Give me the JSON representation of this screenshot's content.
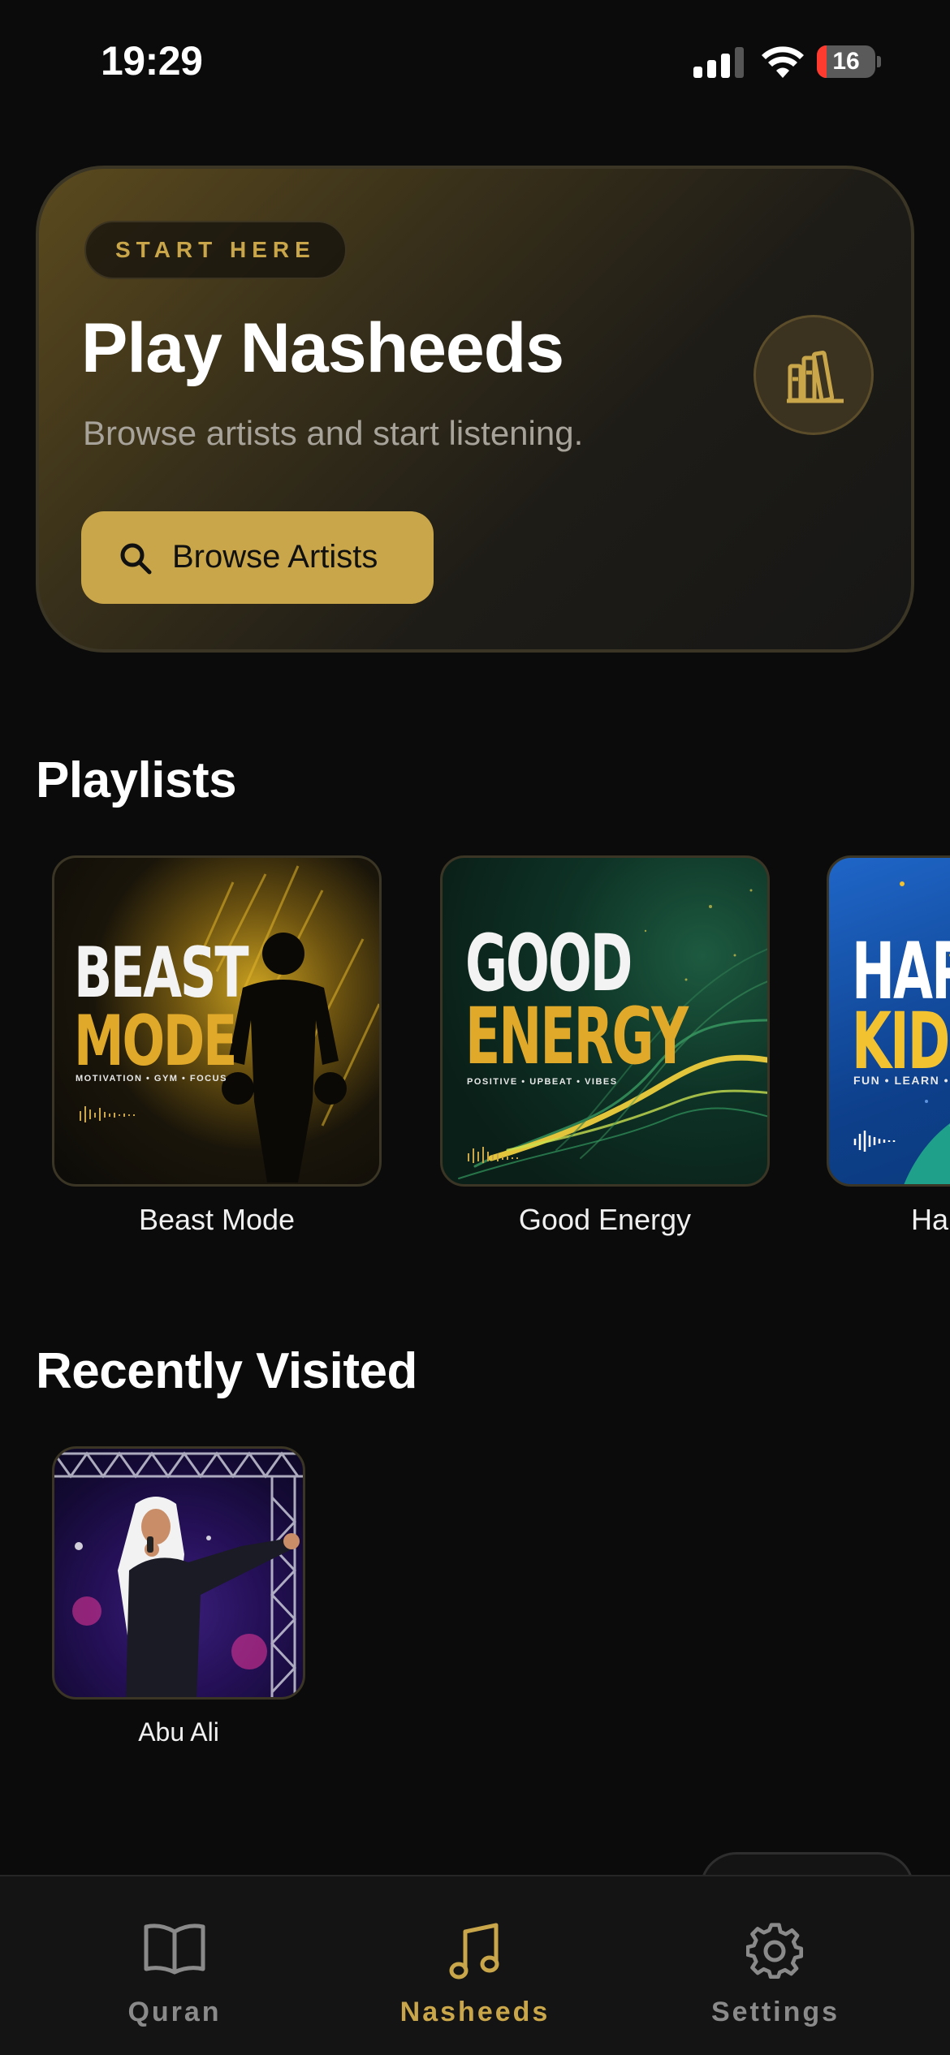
{
  "status_bar": {
    "time": "19:29",
    "battery_level": "16",
    "battery_fraction": 0.16
  },
  "hero": {
    "badge": "START HERE",
    "title": "Play Nasheeds",
    "subtitle": "Browse artists and start listening.",
    "button_label": "Browse Artists",
    "button_icon": "search-icon",
    "side_icon": "books-icon",
    "accent_color": "#c9a64a"
  },
  "playlists": {
    "heading": "Playlists",
    "items": [
      {
        "label": "Beast Mode",
        "cover_line1": "BEAST",
        "cover_line2": "MODE",
        "cover_tagline": "MOTIVATION • GYM • FOCUS"
      },
      {
        "label": "Good Energy",
        "cover_line1": "GOOD",
        "cover_line2": "ENERGY",
        "cover_tagline": "POSITIVE • UPBEAT • VIBES"
      },
      {
        "label": "Ha",
        "cover_line1": "HAP",
        "cover_line2": "KIDS",
        "cover_tagline": "FUN • LEARN • S"
      }
    ]
  },
  "recently_visited": {
    "heading": "Recently Visited",
    "items": [
      {
        "label": "Abu Ali"
      }
    ]
  },
  "tab_bar": {
    "tabs": [
      {
        "label": "Quran",
        "icon": "book-icon",
        "active": false
      },
      {
        "label": "Nasheeds",
        "icon": "music-note-icon",
        "active": true
      },
      {
        "label": "Settings",
        "icon": "gear-icon",
        "active": false
      }
    ],
    "active_color": "#c9a64a",
    "inactive_color": "#8a8a8a"
  }
}
